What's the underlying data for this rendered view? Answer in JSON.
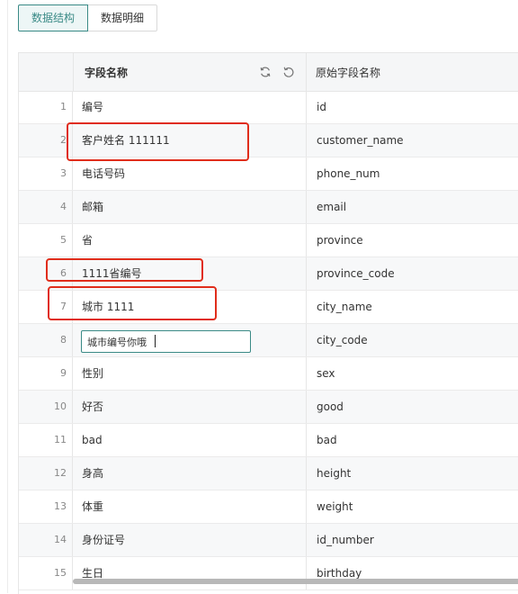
{
  "tabs": [
    {
      "label": "数据结构",
      "active": true
    },
    {
      "label": "数据明细",
      "active": false
    }
  ],
  "table": {
    "columns": {
      "field_name": "字段名称",
      "original_field_name": "原始字段名称"
    },
    "header_icons": [
      "refresh-icon",
      "undo-icon"
    ],
    "rows": [
      {
        "index": "1",
        "field_name": "编号",
        "original": "id"
      },
      {
        "index": "2",
        "field_name": "客户姓名 111111",
        "original": "customer_name"
      },
      {
        "index": "3",
        "field_name": "电话号码",
        "original": "phone_num"
      },
      {
        "index": "4",
        "field_name": "邮箱",
        "original": "email"
      },
      {
        "index": "5",
        "field_name": "省",
        "original": "province"
      },
      {
        "index": "6",
        "field_name": "1111省编号",
        "original": "province_code"
      },
      {
        "index": "7",
        "field_name": "城市 1111",
        "original": "city_name"
      },
      {
        "index": "8",
        "field_name": "城市编号你哦",
        "original": "city_code",
        "editing": true
      },
      {
        "index": "9",
        "field_name": "性别",
        "original": "sex"
      },
      {
        "index": "10",
        "field_name": "好否",
        "original": "good"
      },
      {
        "index": "11",
        "field_name": "bad",
        "original": "bad"
      },
      {
        "index": "12",
        "field_name": "身高",
        "original": "height"
      },
      {
        "index": "13",
        "field_name": "体重",
        "original": "weight"
      },
      {
        "index": "14",
        "field_name": "身份证号",
        "original": "id_number"
      },
      {
        "index": "15",
        "field_name": "生日",
        "original": "birthday"
      }
    ]
  },
  "annotation_color": "#e02d1b",
  "accent_color": "#3a8a86"
}
